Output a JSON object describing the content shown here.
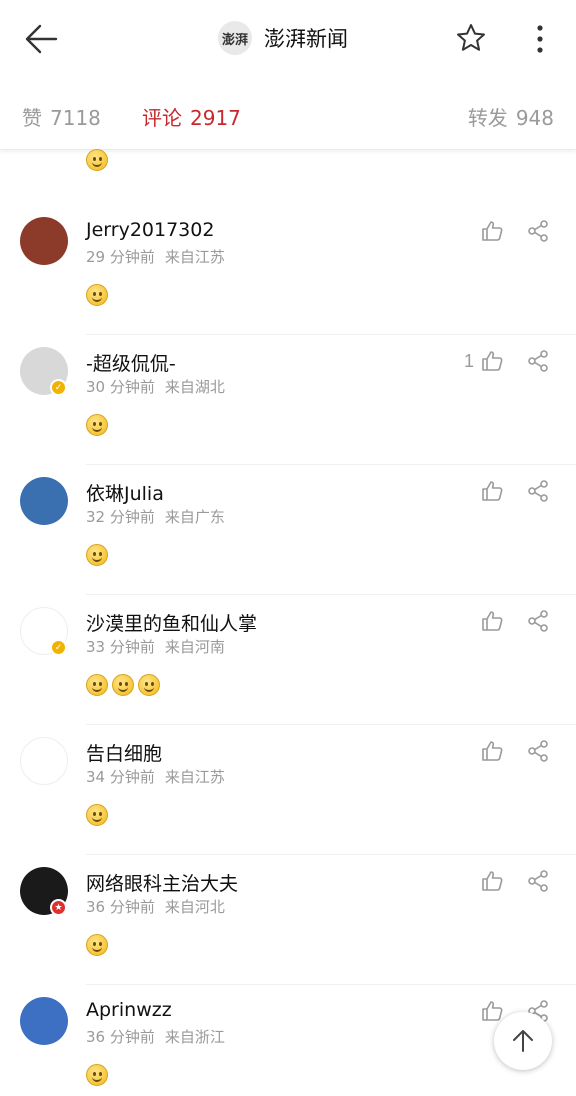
{
  "header": {
    "brand_logo_text": "澎湃",
    "brand_name": "澎湃新闻"
  },
  "tabs": [
    {
      "label": "赞",
      "count": "7118"
    },
    {
      "label": "评论",
      "count": "2917"
    },
    {
      "label": "转发",
      "count": "948"
    }
  ],
  "colors": {
    "accent": "#c8282d",
    "muted": "#9a9a9a",
    "emoji": "#f5c638"
  },
  "comments": [
    {
      "name": "Jerry2017302",
      "time": "29 分钟前",
      "location": "来自江苏",
      "likes": "",
      "emojis": 1,
      "avatar_bg": "#8c3a2a",
      "badge": ""
    },
    {
      "name": "-超级侃侃-",
      "time": "30 分钟前",
      "location": "来自湖北",
      "likes": "1",
      "emojis": 1,
      "avatar_bg": "#d8d8d8",
      "badge": "gold"
    },
    {
      "name": "依琳Julia",
      "time": "32 分钟前",
      "location": "来自广东",
      "likes": "",
      "emojis": 1,
      "avatar_bg": "#3a6fb0",
      "badge": ""
    },
    {
      "name": "沙漠里的鱼和仙人掌",
      "time": "33 分钟前",
      "location": "来自河南",
      "likes": "",
      "emojis": 3,
      "avatar_bg": "#ffffff",
      "badge": "gold"
    },
    {
      "name": "告白细胞",
      "time": "34 分钟前",
      "location": "来自江苏",
      "likes": "",
      "emojis": 1,
      "avatar_bg": "#ffffff",
      "badge": ""
    },
    {
      "name": "网络眼科主治大夫",
      "time": "36 分钟前",
      "location": "来自河北",
      "likes": "",
      "emojis": 1,
      "avatar_bg": "#1a1a1a",
      "badge": "red"
    },
    {
      "name": "Aprinwzz",
      "time": "36 分钟前",
      "location": "来自浙江",
      "likes": "",
      "emojis": 1,
      "avatar_bg": "#3d6fc2",
      "badge": ""
    }
  ],
  "icons": {
    "back": "back-arrow-icon",
    "star": "star-icon",
    "more": "more-vertical-icon",
    "like": "thumbs-up-icon",
    "share": "share-icon",
    "scroll_top": "arrow-up-icon"
  }
}
